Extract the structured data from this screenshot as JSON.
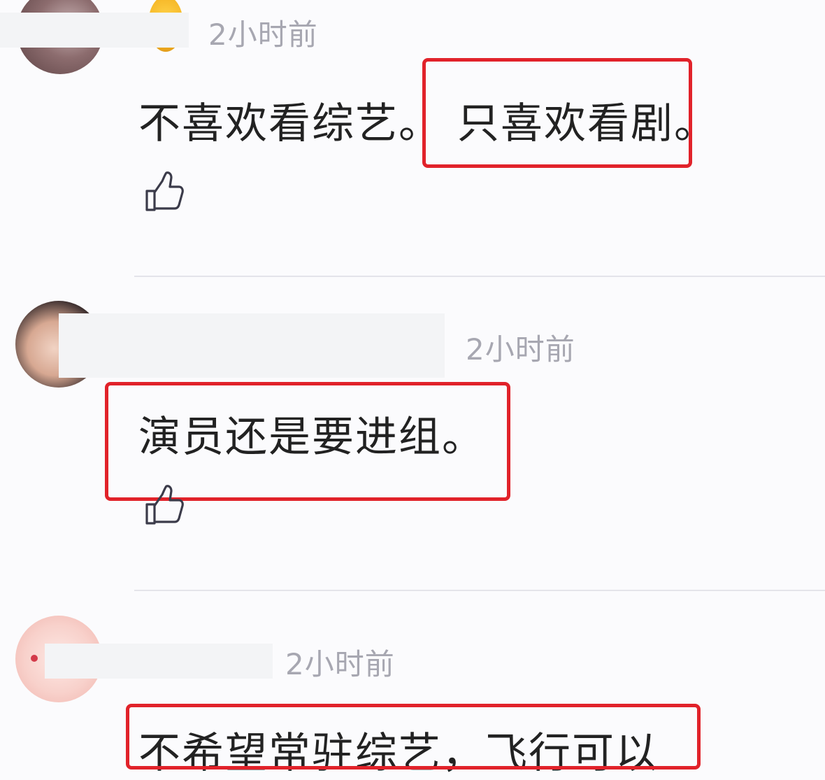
{
  "comments": [
    {
      "time": "2小时前",
      "text_a": "不喜欢看综艺。",
      "text_b": "只喜欢看剧。"
    },
    {
      "time": "2小时前",
      "text": "演员还是要进组。"
    },
    {
      "time": "2小时前",
      "text": "不希望常驻综艺，飞行可以"
    }
  ],
  "colors": {
    "highlight": "#e1222a",
    "time": "#a7a7b1",
    "text": "#222222",
    "divider": "#e4e4ea"
  },
  "icons": {
    "like": "thumbs-up-icon"
  }
}
